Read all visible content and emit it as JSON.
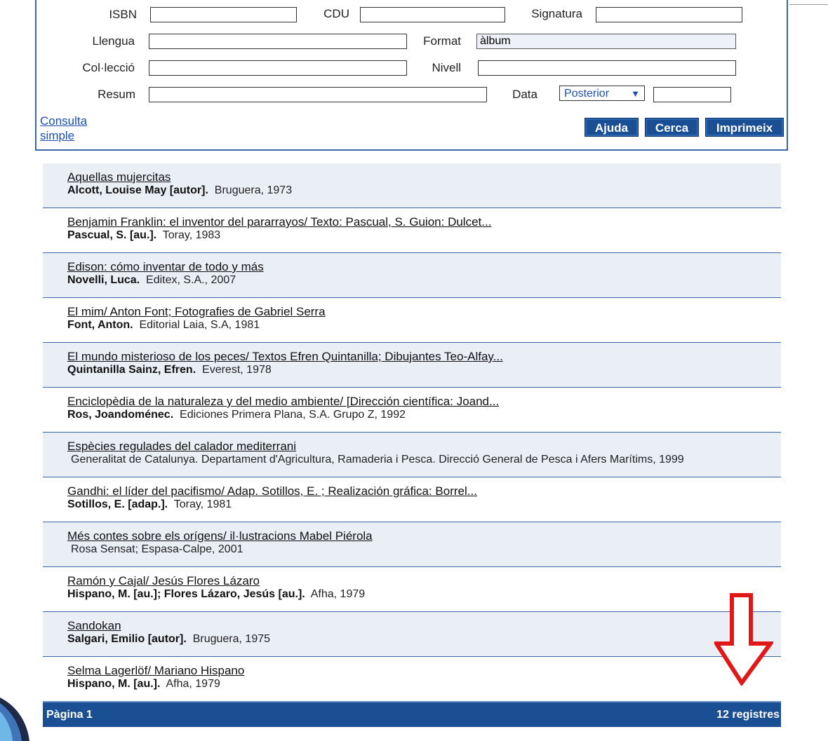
{
  "form": {
    "isbn_label": "ISBN",
    "cdu_label": "CDU",
    "signatura_label": "Signatura",
    "llengua_label": "Llengua",
    "format_label": "Format",
    "format_value": "àlbum",
    "colleccio_label": "Col·lecció",
    "nivell_label": "Nivell",
    "resum_label": "Resum",
    "data_label": "Data",
    "data_select": "Posterior",
    "consulta_line1": "Consulta",
    "consulta_line2": "simple",
    "buttons": {
      "ajuda": "Ajuda",
      "cerca": "Cerca",
      "imprimeix": "Imprimeix"
    }
  },
  "results": [
    {
      "title": "Aquellas mujercitas",
      "author": "Alcott, Louise May [autor].",
      "pub": "Bruguera, 1973"
    },
    {
      "title": "Benjamin Franklin: el inventor del pararrayos/ Texto: Pascual, S. Guion: Dulcet...",
      "author": "Pascual, S. [au.].",
      "pub": "Toray, 1983"
    },
    {
      "title": "Edison: cómo inventar de todo y más",
      "author": "Novelli, Luca.",
      "pub": "Editex, S.A., 2007"
    },
    {
      "title": "El mim/ Anton Font; Fotografies de Gabriel Serra",
      "author": "Font, Anton.",
      "pub": "Editorial Laia, S.A, 1981"
    },
    {
      "title": "El mundo misterioso de los peces/ Textos Efren Quintanilla; Dibujantes Teo-Alfay...",
      "author": "Quintanilla Sainz, Efren.",
      "pub": "Everest, 1978"
    },
    {
      "title": "Enciclopèdia de la naturaleza y del medio ambiente/ [Dirección científica: Joand...",
      "author": "Ros, Joandoménec.",
      "pub": "Ediciones Primera Plana, S.A. Grupo Z, 1992"
    },
    {
      "title": "Espècies regulades del calador mediterrani",
      "author": "",
      "pub": "Generalitat de Catalunya. Departament d'Agricultura, Ramaderia i Pesca. Direcció General de Pesca i Afers Marítims, 1999"
    },
    {
      "title": "Gandhi: el líder del pacifismo/ Adap. Sotillos, E. ; Realización gráfica: Borrel...",
      "author": "Sotillos, E. [adap.].",
      "pub": "Toray, 1981"
    },
    {
      "title": "Més contes sobre els orígens/ il·lustracions Mabel Piérola",
      "author": "",
      "pub": "Rosa Sensat; Espasa-Calpe, 2001"
    },
    {
      "title": "Ramón y Cajal/ Jesús Flores Lázaro",
      "author": "Hispano, M. [au.]; Flores Lázaro, Jesús [au.].",
      "pub": "Afha, 1979"
    },
    {
      "title": "Sandokan",
      "author": "Salgari, Emilio [autor].",
      "pub": "Bruguera, 1975"
    },
    {
      "title": "Selma Lagerlöf/ Mariano Hispano",
      "author": "Hispano, M. [au.].",
      "pub": "Afha, 1979"
    }
  ],
  "pager": {
    "page": "Pàgina 1",
    "count": "12 registres"
  },
  "colors": {
    "accent": "#1a4f94",
    "row_shade": "#eaeef5",
    "arrow": "#e01818"
  }
}
